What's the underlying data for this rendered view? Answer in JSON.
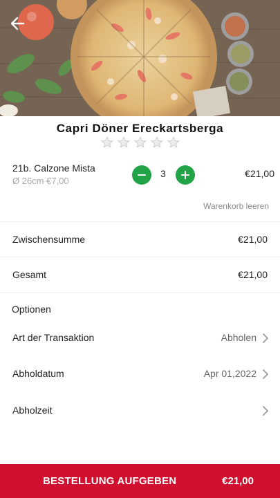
{
  "header": {
    "store_name": "Capri Döner Ereckartsberga",
    "rating": 0,
    "rating_max": 5
  },
  "cart": {
    "items": [
      {
        "name": "21b. Calzone Mista",
        "detail": "Ø 26cm €7,00",
        "quantity": "3",
        "price": "€21,00"
      }
    ],
    "clear_label": "Warenkorb leeren"
  },
  "totals": {
    "subtotal_label": "Zwischensumme",
    "subtotal_value": "€21,00",
    "total_label": "Gesamt",
    "total_value": "€21,00"
  },
  "options": {
    "heading": "Optionen",
    "transaction_label": "Art der Transaktion",
    "transaction_value": "Abholen",
    "date_label": "Abholdatum",
    "date_value": "Apr 01,2022",
    "time_label": "Abholzeit",
    "time_value": ""
  },
  "footer": {
    "order_label": "BESTELLUNG AUFGEBEN",
    "order_total": "€21,00"
  },
  "colors": {
    "accent_green": "#23a348",
    "order_red": "#d0102e",
    "muted_text": "#a8a8a8"
  },
  "icons": {
    "back": "arrow-left-icon",
    "star": "star-icon",
    "minus": "minus-icon",
    "plus": "plus-icon",
    "chevron": "chevron-right-icon"
  }
}
